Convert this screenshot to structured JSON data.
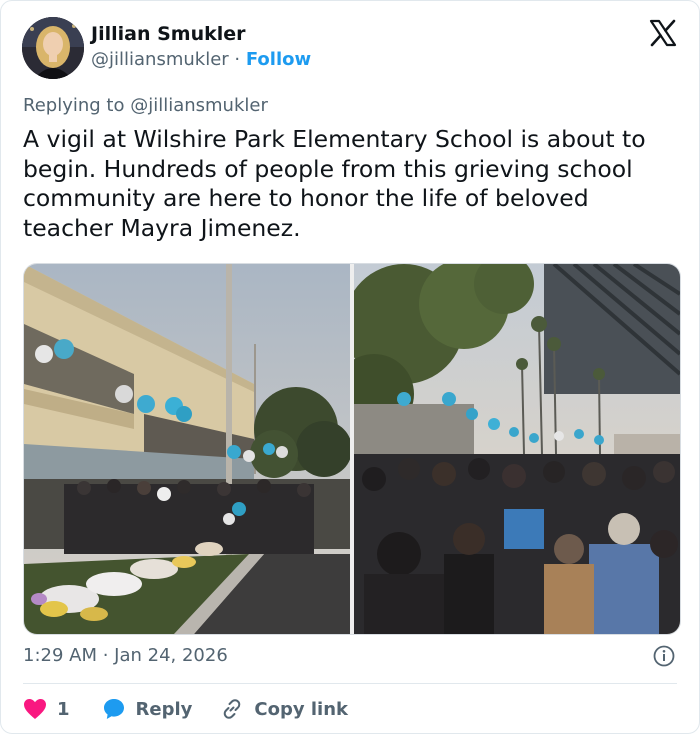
{
  "author": {
    "name": "Jillian Smukler",
    "handle": "@jilliansmukler",
    "separator": " · ",
    "follow_label": "Follow"
  },
  "reply_to": "Replying to @jilliansmukler",
  "tweet_text": "A vigil at Wilshire Park Elementary School is about to begin. Hundreds of people from this grieving school community are here to honor the life of beloved teacher Mayra Jimenez.",
  "timestamp": "1:29 AM · Jan 24, 2026",
  "actions": {
    "like_count": "1",
    "reply_label": "Reply",
    "copy_link_label": "Copy link"
  },
  "icons": [
    "x-logo-icon",
    "info-icon",
    "heart-icon",
    "reply-bubble-icon",
    "link-icon"
  ],
  "colors": {
    "accent": "#1d9bf0",
    "like": "#f91880",
    "text": "#0f1419",
    "secondary": "#536471",
    "border": "#e1e8ed"
  }
}
